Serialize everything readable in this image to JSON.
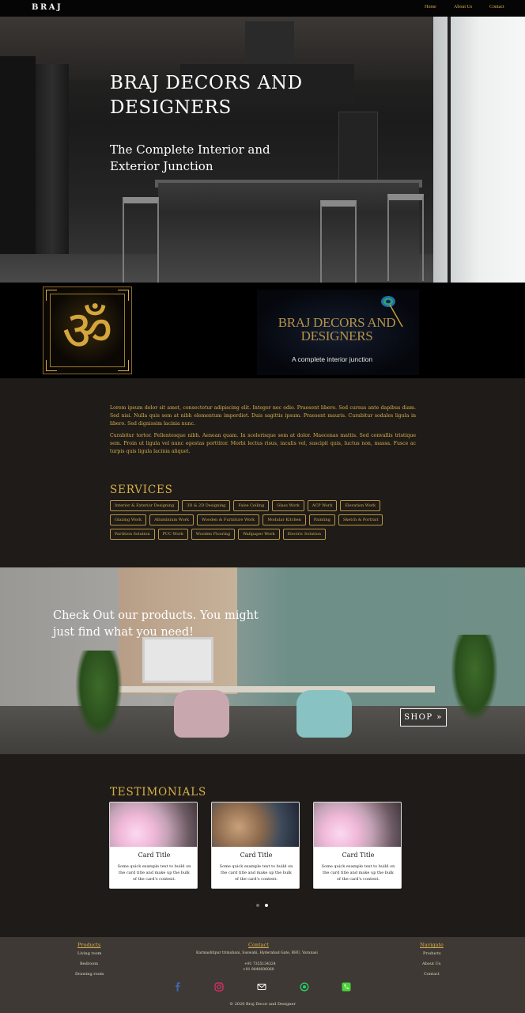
{
  "navbar": {
    "brand": "BRAJ",
    "links": [
      "Home",
      "About Us",
      "Contact"
    ]
  },
  "hero": {
    "title": "BRAJ DECORS AND DESIGNERS",
    "subtitle": "The Complete Interior and Exterior Junction"
  },
  "logo": {
    "name": "BRAJ DECORS AND DESIGNERS",
    "tagline": "A complete interior junction"
  },
  "intro": {
    "paragraph1": "Lorem ipsum dolor sit amet, consectetur adipiscing elit. Integer nec odio. Praesent libero. Sed cursus ante dapibus diam. Sed nisi. Nulla quis sem at nibh elementum imperdiet. Duis sagittis ipsum. Praesent mauris. Curabitur sodales ligula in libero. Sed dignissim lacinia nunc.",
    "paragraph2": "Curabitur tortor. Pellentesque nibh. Aenean quam. In scelerisque sem at dolor. Maecenas mattis. Sed convallis tristique sem. Proin ut ligula vel nunc egestas porttitor. Morbi lectus risus, iaculis vel, suscipit quis, luctus non, massa. Fusce ac turpis quis ligula lacinia aliquet."
  },
  "services": {
    "title": "SERVICES",
    "items": [
      "Interior & Exterior Designing",
      "3D & 2D Designing",
      "False Ceiling",
      "Glass Work",
      "ACP Work",
      "Elevation Work",
      "Glazing Work",
      "Alluminium Work",
      "Wooden & Furniture Work",
      "Modular Kitchen",
      "Painting",
      "Sketch & Portrait",
      "Partition Solution",
      "PUC Work",
      "Wooden Flooring",
      "Wallpaper Work",
      "Electric Solution"
    ]
  },
  "promo": {
    "text": "Check Out our products. You might just find what you need!",
    "button": "SHOP"
  },
  "testimonials": {
    "title": "TESTIMONIALS",
    "cards": [
      {
        "title": "Card Title",
        "text": "Some quick example text to build on the card title and make up the bulk of the card's content."
      },
      {
        "title": "Card Title",
        "text": "Some quick example text to build on the card title and make up the bulk of the card's content."
      },
      {
        "title": "Card Title",
        "text": "Some quick example text to build on the card title and make up the bulk of the card's content."
      }
    ]
  },
  "footer": {
    "products": {
      "heading": "Products",
      "items": [
        "Living room",
        "Bedroom",
        "Drawing room"
      ]
    },
    "contact": {
      "heading": "Contact",
      "address": "Karmashtipur trimuhani, Suswahi, Hyderabad Gate, BHU, Varanasi",
      "phone1": "+91 7355134324",
      "phone2": "+91 9840606060"
    },
    "navigate": {
      "heading": "Navigate",
      "items": [
        "Products",
        "About Us",
        "Contact"
      ]
    },
    "social_icons": [
      "facebook-icon",
      "instagram-icon",
      "email-icon",
      "whatsapp-icon",
      "phone-icon"
    ],
    "copyright": "© 2020 Braj Decor and Designer"
  },
  "colors": {
    "accent_gold": "#d8b14a",
    "background": "#1f1b18",
    "footer_bg": "#3e3934",
    "facebook": "#4267b2",
    "instagram": "#e1306c",
    "whatsapp": "#25d366",
    "phone": "#4cd137"
  }
}
